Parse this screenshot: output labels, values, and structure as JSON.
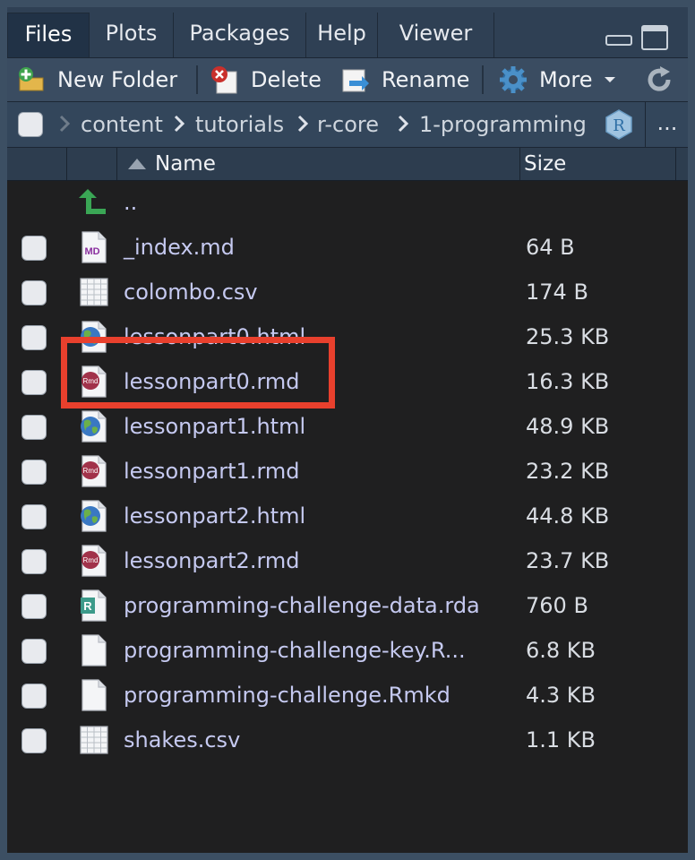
{
  "tabs": [
    {
      "label": "Files",
      "active": true
    },
    {
      "label": "Plots"
    },
    {
      "label": "Packages"
    },
    {
      "label": "Help"
    },
    {
      "label": "Viewer"
    }
  ],
  "toolbar": {
    "new_folder": "New Folder",
    "delete": "Delete",
    "rename": "Rename",
    "more": "More"
  },
  "breadcrumb": {
    "items": [
      "content",
      "tutorials",
      "r-core",
      "1-programming"
    ],
    "overflow": "..."
  },
  "header": {
    "name": "Name",
    "size": "Size"
  },
  "parent_dir": "..",
  "files": [
    {
      "name": "_index.md",
      "size": "64 B",
      "icon": "markdown-file-icon"
    },
    {
      "name": "colombo.csv",
      "size": "174 B",
      "icon": "csv-file-icon"
    },
    {
      "name": "lessonpart0.html",
      "size": "25.3 KB",
      "icon": "html-file-icon"
    },
    {
      "name": "lessonpart0.rmd",
      "size": "16.3 KB",
      "icon": "rmarkdown-file-icon",
      "highlighted": true
    },
    {
      "name": "lessonpart1.html",
      "size": "48.9 KB",
      "icon": "html-file-icon"
    },
    {
      "name": "lessonpart1.rmd",
      "size": "23.2 KB",
      "icon": "rmarkdown-file-icon"
    },
    {
      "name": "lessonpart2.html",
      "size": "44.8 KB",
      "icon": "html-file-icon"
    },
    {
      "name": "lessonpart2.rmd",
      "size": "23.7 KB",
      "icon": "rmarkdown-file-icon"
    },
    {
      "name": "programming-challenge-data.rda",
      "size": "760 B",
      "icon": "rdata-file-icon"
    },
    {
      "name": "programming-challenge-key.R...",
      "size": "6.8 KB",
      "icon": "blank-file-icon"
    },
    {
      "name": "programming-challenge.Rmkd",
      "size": "4.3 KB",
      "icon": "blank-file-icon"
    },
    {
      "name": "shakes.csv",
      "size": "1.1 KB",
      "icon": "csv-file-icon"
    }
  ],
  "icon_labels": {
    "md": "MD",
    "rmd": "Rmd",
    "r": "R"
  },
  "colors": {
    "highlight": "#e8402d",
    "file_link": "#c5c9f0",
    "pane_bg": "#1f1f20"
  }
}
